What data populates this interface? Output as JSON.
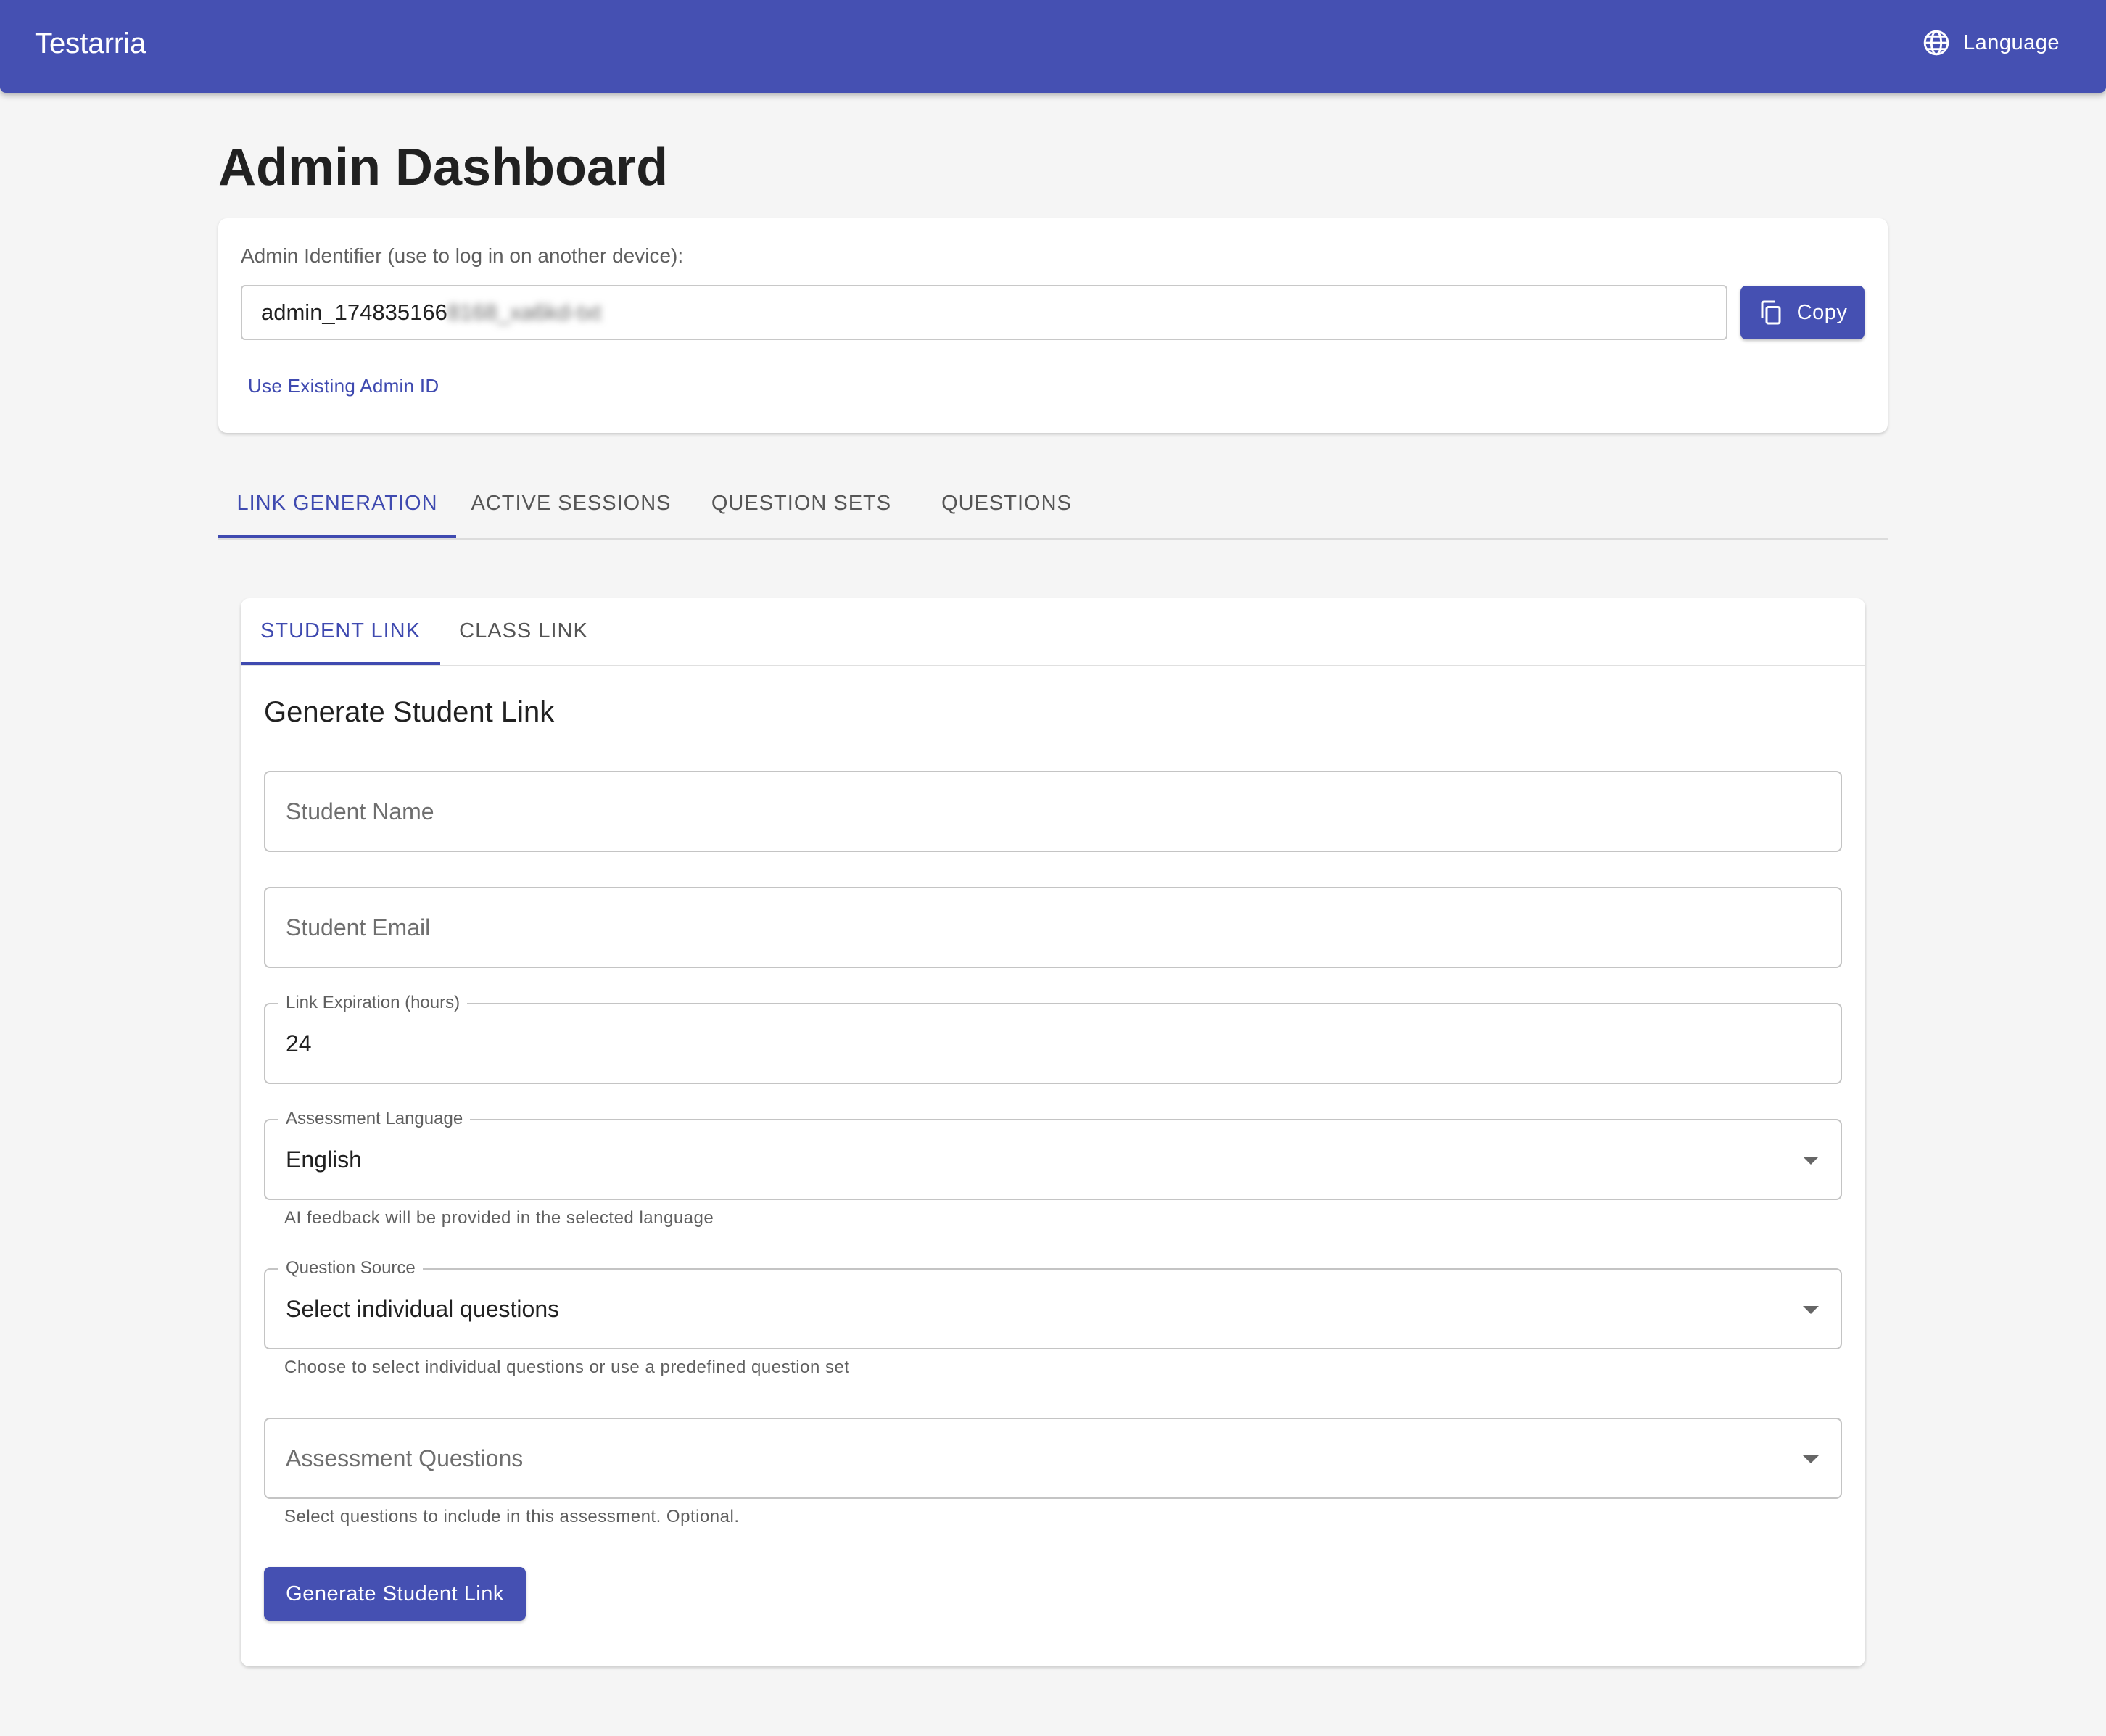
{
  "app": {
    "title": "Testarria",
    "language_label": "Language"
  },
  "page": {
    "title": "Admin Dashboard"
  },
  "admin": {
    "label": "Admin Identifier (use to log in on another device):",
    "id_visible": "admin_174835166",
    "id_obscured": "8168_xa6kd-txt",
    "copy_label": "Copy",
    "existing_link": "Use Existing Admin ID"
  },
  "tabs": [
    {
      "label": "LINK GENERATION",
      "active": true
    },
    {
      "label": "ACTIVE SESSIONS",
      "active": false
    },
    {
      "label": "QUESTION SETS",
      "active": false
    },
    {
      "label": "QUESTIONS",
      "active": false
    }
  ],
  "subtabs": [
    {
      "label": "STUDENT LINK",
      "active": true
    },
    {
      "label": "CLASS LINK",
      "active": false
    }
  ],
  "form": {
    "title": "Generate Student Link",
    "student_name_placeholder": "Student Name",
    "student_email_placeholder": "Student Email",
    "expiration_label": "Link Expiration (hours)",
    "expiration_value": "24",
    "language_label": "Assessment Language",
    "language_value": "English",
    "language_helper": "AI feedback will be provided in the selected language",
    "source_label": "Question Source",
    "source_value": "Select individual questions",
    "source_helper": "Choose to select individual questions or use a predefined question set",
    "questions_placeholder": "Assessment Questions",
    "questions_helper": "Select questions to include in this assessment. Optional.",
    "submit_label": "Generate Student Link"
  },
  "colors": {
    "primary": "#4550b2",
    "background": "#f5f5f5"
  },
  "icons": {
    "language": "globe-icon",
    "copy": "copy-icon",
    "dropdown": "caret-down-icon"
  }
}
